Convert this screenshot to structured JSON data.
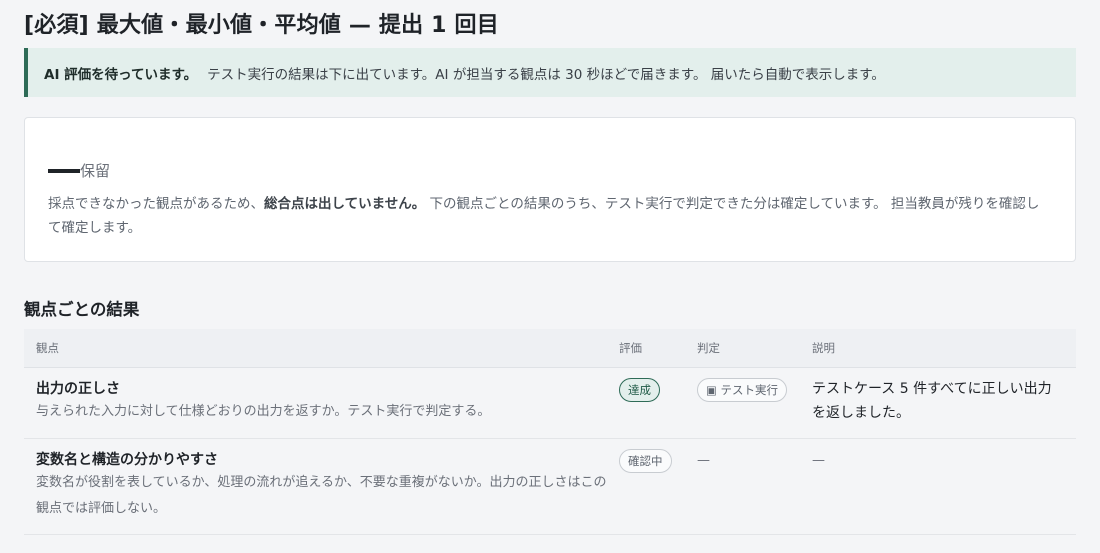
{
  "page": {
    "title": "[必須] 最大値・最小値・平均値 — 提出 1 回目"
  },
  "notice": {
    "strong": "AI 評価を待っています。",
    "text": "テスト実行の結果は下に出ています。AI が担当する観点は 30 秒ほどで届きます。 届いたら自動で表示します。"
  },
  "summary": {
    "status": "保留",
    "body_before": "採点できなかった観点があるため、",
    "body_strong": "総合点は出していません。",
    "body_after": " 下の観点ごとの結果のうち、テスト実行で判定できた分は確定しています。 担当教員が残りを確認して確定します。"
  },
  "section": {
    "title": "観点ごとの結果"
  },
  "table": {
    "headers": {
      "criterion": "観点",
      "grade": "評価",
      "judge": "判定",
      "explanation": "説明"
    },
    "rows": [
      {
        "name": "出力の正しさ",
        "description": "与えられた入力に対して仕様どおりの出力を返すか。テスト実行で判定する。",
        "grade": "達成",
        "judge": "▣ テスト実行",
        "explanation": "テストケース 5 件すべてに正しい出力を返しました。"
      },
      {
        "name": "変数名と構造の分かりやすさ",
        "description": "変数名が役割を表しているか、処理の流れが追えるか、不要な重複がないか。出力の正しさはこの観点では評価しない。",
        "grade": "確認中",
        "judge": "—",
        "explanation": "—"
      }
    ]
  },
  "colors": {
    "accent": "#2e6b57",
    "notice_bg": "#e3efec"
  }
}
